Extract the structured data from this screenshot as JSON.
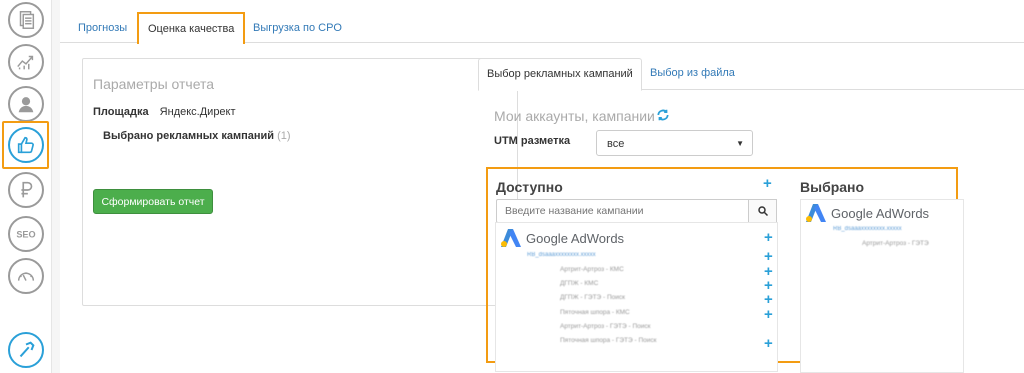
{
  "tabs": [
    "Прогнозы",
    "Оценка качества",
    "Выгрузка по CPO"
  ],
  "report": {
    "title": "Параметры отчета",
    "platform_label": "Площадка",
    "platform_value": "Яндекс.Директ",
    "selected_label": "Выбрано рекламных кампаний",
    "selected_count": "(1)",
    "button": "Сформировать отчет"
  },
  "right_tabs": [
    "Выбор рекламных кампаний",
    "Выбор из файла"
  ],
  "accounts_title": "Мои аккаунты, кампании",
  "utm": {
    "label": "UTM разметка",
    "value": "все"
  },
  "available": {
    "title": "Доступно",
    "search_placeholder": "Введите название кампании",
    "account": "RB_dsaaaxxxxxxxx.xxxxx",
    "campaigns": [
      "Артрит-Артроз - КМС",
      "ДГПЖ - КМС",
      "ДГПЖ - ГЭТЭ - Поиск",
      "Пяточная шпора - КМС",
      "Артрит-Артроз - ГЭТЭ - Поиск",
      "Пяточная шпора - ГЭТЭ - Поиск"
    ]
  },
  "selected": {
    "title": "Выбрано",
    "account": "RB_dsaaaxxxxxxxx.xxxxx",
    "campaign": "Артрит-Артроз - ГЭТЭ"
  },
  "logo": {
    "google": "Google",
    "adwords": "AdWords"
  }
}
